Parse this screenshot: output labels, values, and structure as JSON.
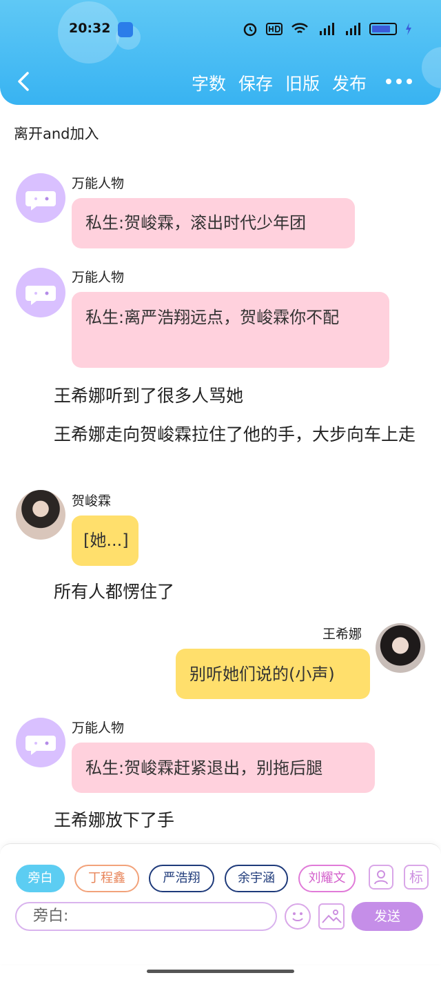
{
  "status": {
    "time": "20:32",
    "icons": [
      "alarm-icon",
      "hd-icon",
      "wifi-icon",
      "4g-signal-icon",
      "5g-signal-icon",
      "battery-icon",
      "charging-icon"
    ]
  },
  "nav": {
    "word_count": "字数",
    "save": "保存",
    "old_version": "旧版",
    "publish": "发布"
  },
  "chapter": {
    "title": "离开and加入"
  },
  "items": [
    {
      "type": "msg",
      "speaker": "万能人物",
      "text": "私生:贺峻霖，滚出时代少年团"
    },
    {
      "type": "msg",
      "speaker": "万能人物",
      "text": "私生:离严浩翔远点，贺峻霖你不配"
    },
    {
      "type": "narration",
      "text": "王希娜听到了很多人骂她"
    },
    {
      "type": "narration",
      "text": "王希娜走向贺峻霖拉住了他的手，大步向车上走"
    },
    {
      "type": "msg",
      "speaker": "贺峻霖",
      "text": "[她...]"
    },
    {
      "type": "narration",
      "text": "所有人都愣住了"
    },
    {
      "type": "msg",
      "speaker": "王希娜",
      "text": "别听她们说的(小声)"
    },
    {
      "type": "msg",
      "speaker": "万能人物",
      "text": "私生:贺峻霖赶紧退出，别拖后腿"
    },
    {
      "type": "narration",
      "text": "王希娜放下了手"
    }
  ],
  "composer": {
    "chips": [
      "旁白",
      "丁程鑫",
      "严浩翔",
      "余宇涵",
      "刘耀文"
    ],
    "mark_label": "标",
    "input_value": "旁白:",
    "send_label": "发送"
  },
  "colors": {
    "header": "#38b3f2",
    "pink_bubble": "#ffd1dd",
    "yellow_bubble": "#ffdf6c",
    "send": "#c58ee8",
    "active_chip": "#5ccdf2"
  }
}
